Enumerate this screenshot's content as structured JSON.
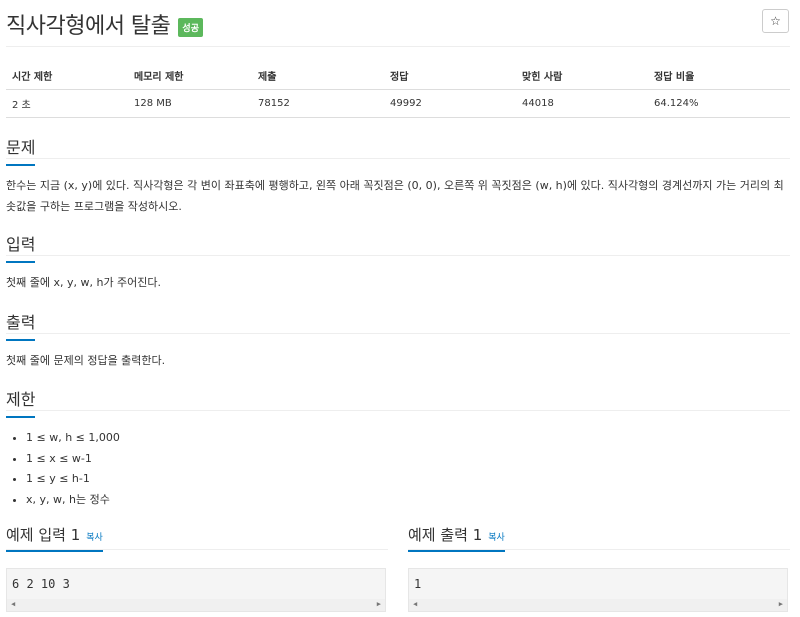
{
  "problem": {
    "title": "직사각형에서 탈출",
    "status_badge": "성공",
    "star_icon": "☆"
  },
  "info_table": {
    "headers": [
      "시간 제한",
      "메모리 제한",
      "제출",
      "정답",
      "맞힌 사람",
      "정답 비율"
    ],
    "row": [
      "2 초",
      "128 MB",
      "78152",
      "49992",
      "44018",
      "64.124%"
    ]
  },
  "sections": {
    "description": {
      "title": "문제",
      "text": "한수는 지금 (x, y)에 있다. 직사각형은 각 변이 좌표축에 평행하고, 왼쪽 아래 꼭짓점은 (0, 0), 오른쪽 위 꼭짓점은 (w, h)에 있다. 직사각형의 경계선까지 가는 거리의 최솟값을 구하는 프로그램을 작성하시오."
    },
    "input": {
      "title": "입력",
      "text": "첫째 줄에 x, y, w, h가 주어진다."
    },
    "output": {
      "title": "출력",
      "text": "첫째 줄에 문제의 정답을 출력한다."
    },
    "limits": {
      "title": "제한",
      "items": [
        "1 ≤ w, h ≤ 1,000",
        "1 ≤ x ≤ w-1",
        "1 ≤ y ≤ h-1",
        "x, y, w, h는 정수"
      ]
    }
  },
  "examples": {
    "input": {
      "title": "예제 입력 1",
      "copy_label": "복사",
      "content": "6 2 10 3"
    },
    "output": {
      "title": "예제 출력 1",
      "copy_label": "복사",
      "content": "1"
    }
  },
  "scroll_arrows": {
    "left": "◀",
    "right": "▶"
  }
}
